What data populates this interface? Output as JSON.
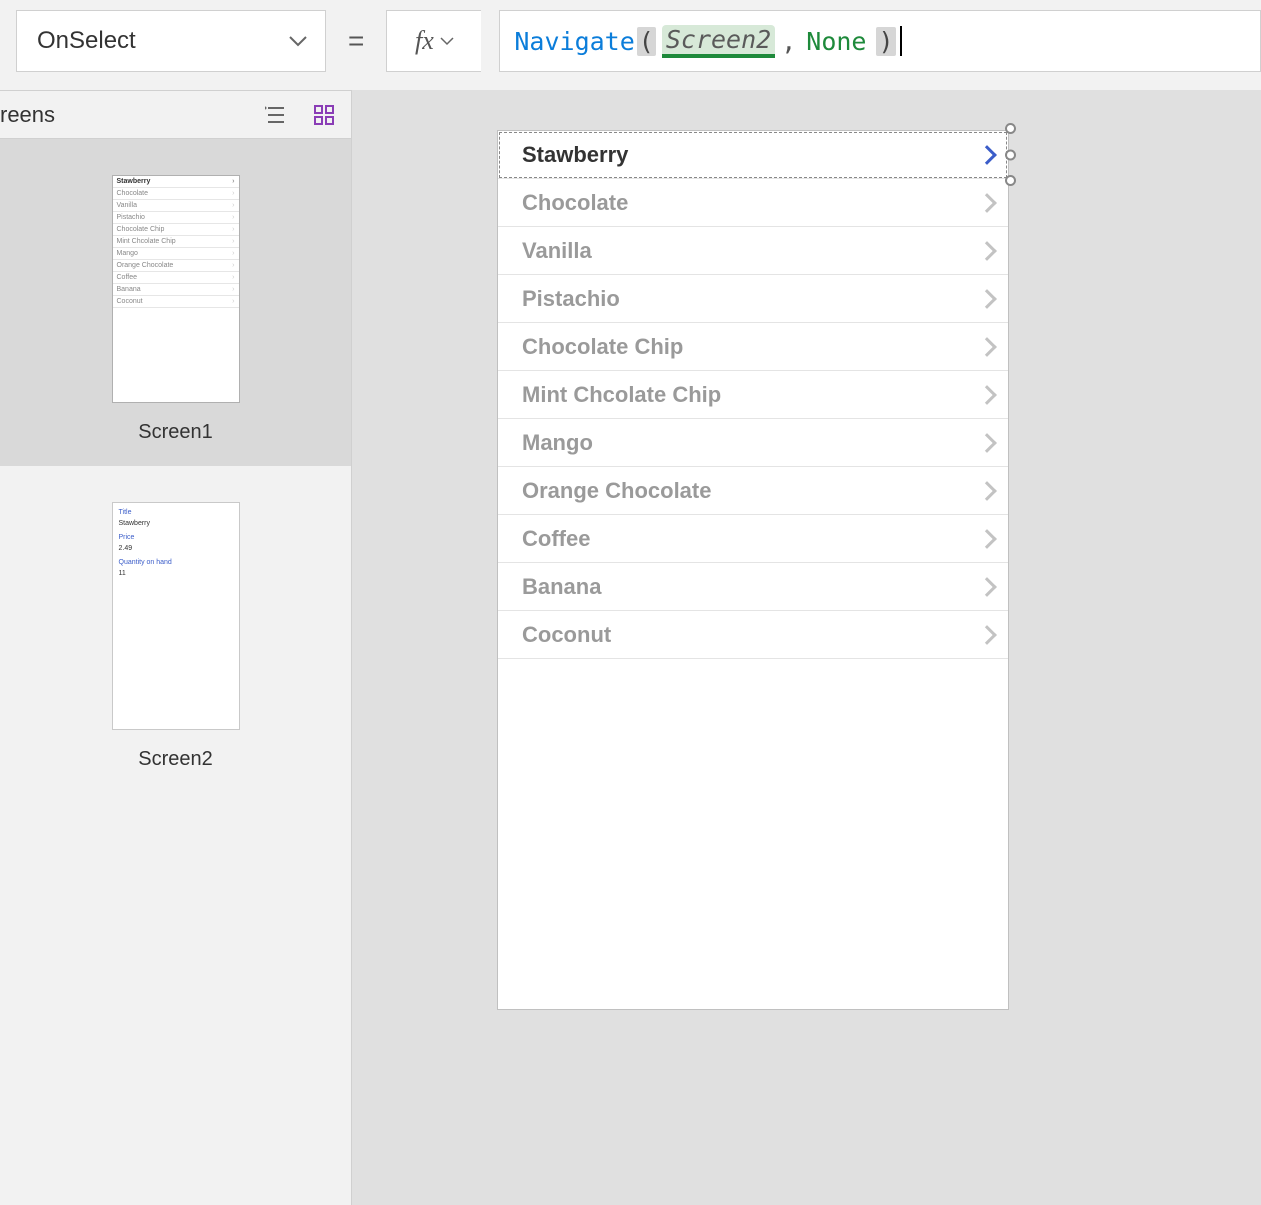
{
  "formula_bar": {
    "property": "OnSelect",
    "equals": "=",
    "fx_label": "fx",
    "tokens": {
      "fn": "Navigate",
      "open_paren": "(",
      "arg1": "Screen2",
      "comma": ",",
      "arg2": "None",
      "close_paren": ")"
    }
  },
  "tree": {
    "header_label": "reens",
    "thumbnails": [
      {
        "label": "Screen1",
        "selected": true
      },
      {
        "label": "Screen2",
        "selected": false
      }
    ],
    "screen2_detail": {
      "title_label": "Title",
      "title_value": "Stawberry",
      "price_label": "Price",
      "price_value": "2.49",
      "qty_label": "Quantity on hand",
      "qty_value": "11"
    }
  },
  "gallery": {
    "items": [
      {
        "label": "Stawberry",
        "selected": true
      },
      {
        "label": "Chocolate",
        "selected": false
      },
      {
        "label": "Vanilla",
        "selected": false
      },
      {
        "label": "Pistachio",
        "selected": false
      },
      {
        "label": "Chocolate Chip",
        "selected": false
      },
      {
        "label": "Mint Chcolate Chip",
        "selected": false
      },
      {
        "label": "Mango",
        "selected": false
      },
      {
        "label": "Orange Chocolate",
        "selected": false
      },
      {
        "label": "Coffee",
        "selected": false
      },
      {
        "label": "Banana",
        "selected": false
      },
      {
        "label": "Coconut",
        "selected": false
      }
    ]
  }
}
